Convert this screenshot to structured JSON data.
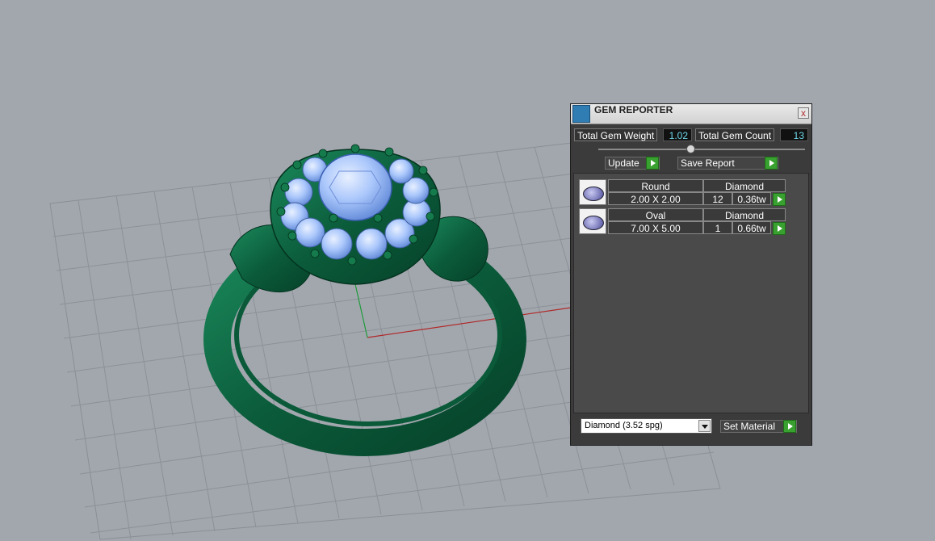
{
  "panel": {
    "title": "GEM REPORTER",
    "close_label": "x",
    "total_gem_weight_label": "Total Gem Weight",
    "total_gem_weight_value": "1.02",
    "total_gem_count_label": "Total Gem Count",
    "total_gem_count_value": "13",
    "update_label": "Update",
    "save_report_label": "Save Report",
    "set_material_label": "Set Material",
    "material_select_value": "Diamond      (3.52 spg)",
    "gems": [
      {
        "cut": "Round",
        "material": "Diamond",
        "size": "2.00 X 2.00",
        "count": "12",
        "weight": "0.36tw"
      },
      {
        "cut": "Oval",
        "material": "Diamond",
        "size": "7.00 X 5.00",
        "count": "1",
        "weight": "0.66tw"
      }
    ]
  },
  "icons": {
    "app": "gem-reporter-app-icon",
    "close": "close-icon",
    "play": "play-arrow-icon",
    "dropdown": "chevron-down-icon"
  },
  "colors": {
    "viewport_bg": "#a2a7ae",
    "panel_bg": "#3b3b3b",
    "accent_green": "#39a12f",
    "value_text": "#6ed6e8",
    "ring_metal": "#0e6b46",
    "gem_blue": "#8fb4f2"
  }
}
